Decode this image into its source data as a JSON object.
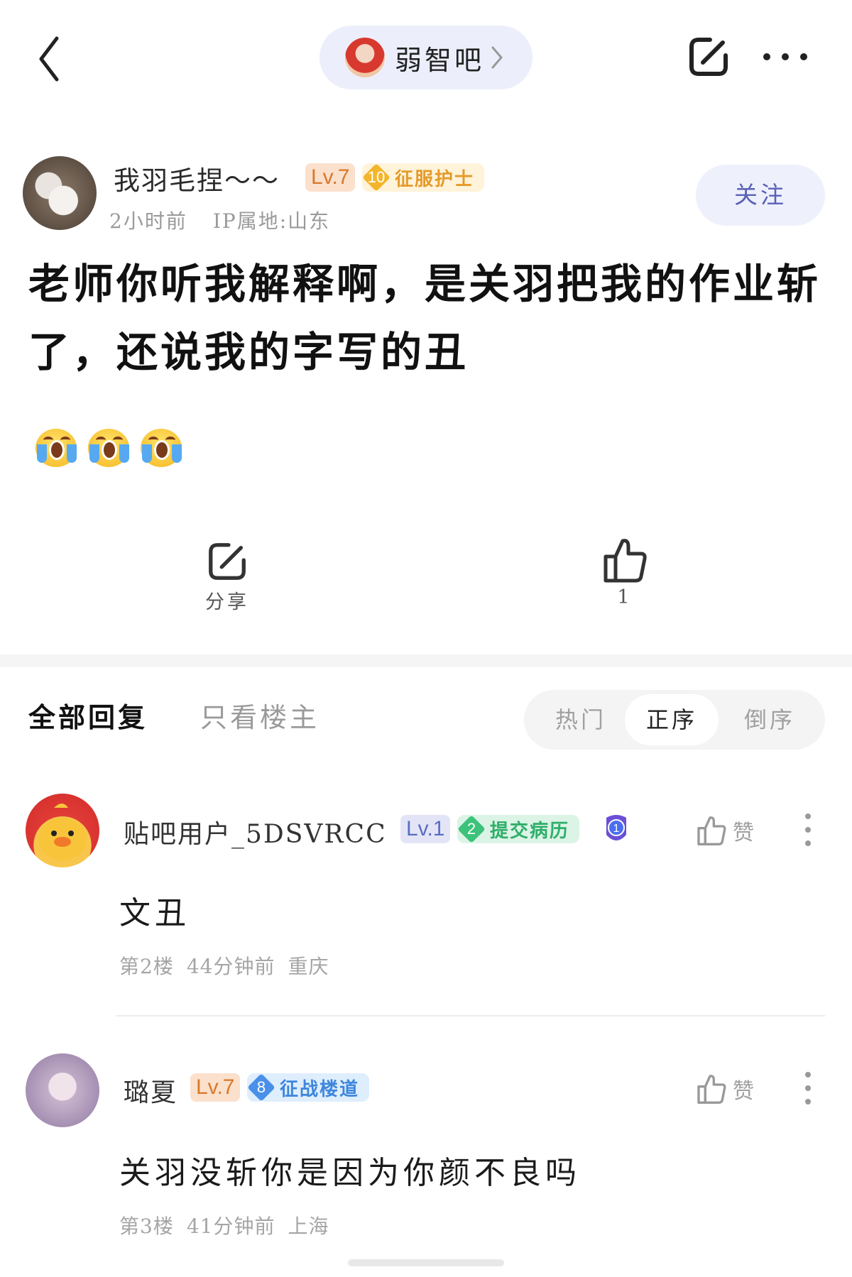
{
  "forum": {
    "name": "弱智吧"
  },
  "author": {
    "name": "我羽毛捏～～",
    "level": "Lv.7",
    "badge_num": "10",
    "badge_title": "征服护士",
    "time": "2小时前",
    "ip": "IP属地:山东",
    "follow_label": "关注"
  },
  "post": {
    "title": "老师你听我解释啊，是关羽把我的作业斩了，还说我的字写的丑",
    "emojis": [
      "crying-face",
      "crying-face",
      "crying-face"
    ]
  },
  "actions": {
    "share_label": "分享",
    "like_count": "1"
  },
  "tabs": {
    "all": "全部回复",
    "op_only": "只看楼主"
  },
  "sort": {
    "hot": "热门",
    "asc": "正序",
    "desc": "倒序",
    "selected": "正序"
  },
  "replies": [
    {
      "name": "贴吧用户_5DSVRCC",
      "level": "Lv.1",
      "badge_num": "2",
      "badge_title": "提交病历",
      "medal": "1",
      "like_label": "赞",
      "text": "文丑",
      "floor": "第2楼",
      "time": "44分钟前",
      "location": "重庆"
    },
    {
      "name": "璐夏",
      "level": "Lv.7",
      "badge_num": "8",
      "badge_title": "征战楼道",
      "like_label": "赞",
      "text": "关羽没斩你是因为你颜不良吗",
      "floor": "第3楼",
      "time": "41分钟前",
      "location": "上海"
    }
  ],
  "colors": {
    "accent": "#5a61b8",
    "level_orange": "#d9782c",
    "level_blue": "#5a6ec0",
    "badge_gold": "#f3b52b",
    "badge_green": "#3cc27a",
    "badge_blue": "#4a90e8"
  }
}
